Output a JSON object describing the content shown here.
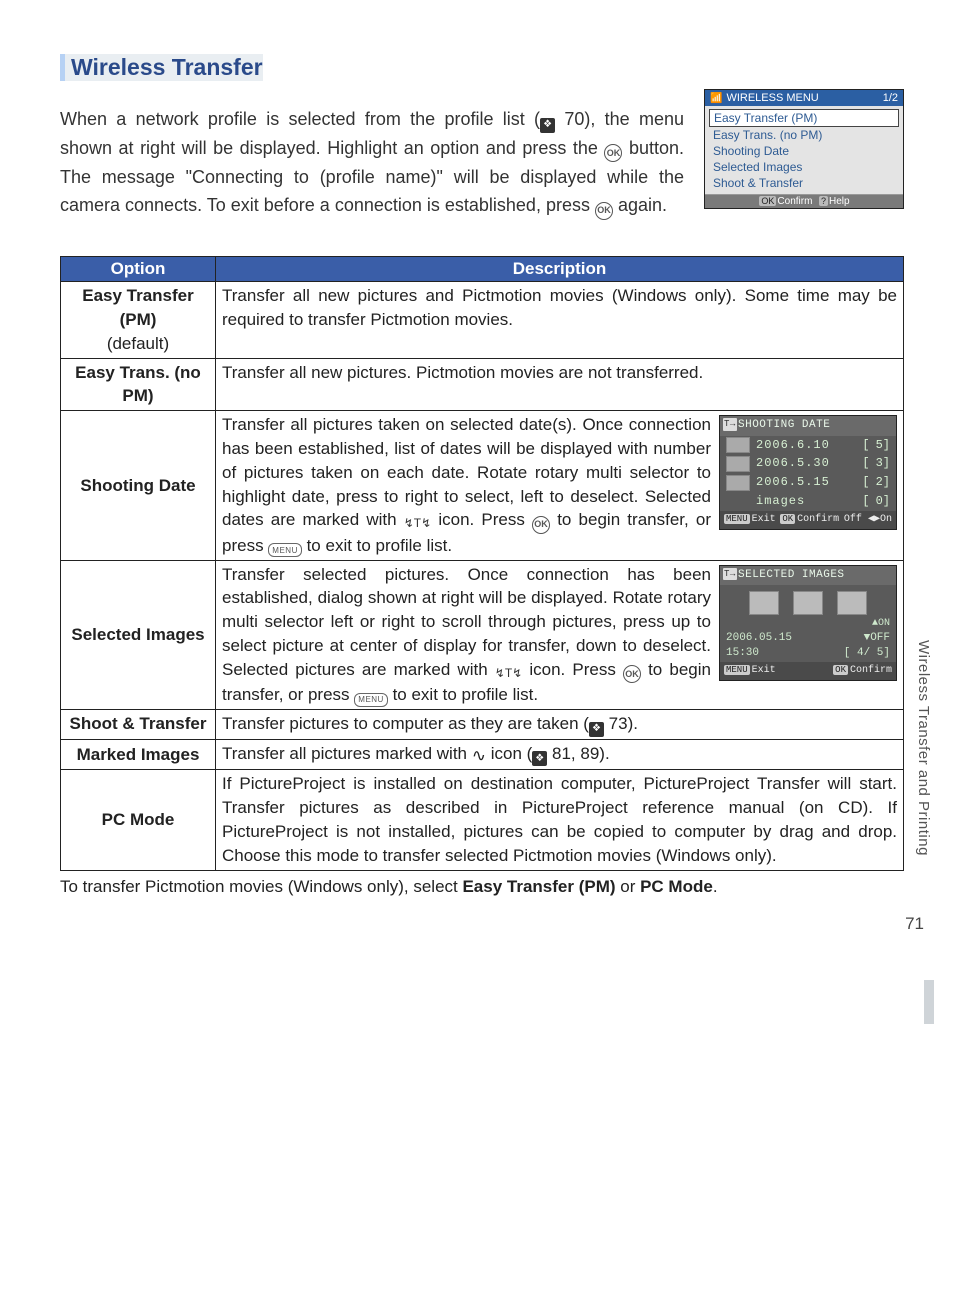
{
  "heading": "Wireless Transfer",
  "intro": {
    "part1": "When a network profile is selected from the profile list (",
    "ref1": "70",
    "part2": "), the menu shown at right will be displayed. Highlight an option and press the ",
    "ok1": "OK",
    "part3": " button. The message \"Connecting to (profile name)\" will be displayed while the camera connects. To exit before a connection is established, press ",
    "ok2": "OK",
    "part4": " again."
  },
  "menu_shot": {
    "title": "WIRELESS MENU",
    "page": "1/2",
    "items": [
      "Easy Transfer (PM)",
      "Easy Trans. (no PM)",
      "Shooting Date",
      "Selected Images",
      "Shoot & Transfer"
    ],
    "foot_confirm": "Confirm",
    "foot_help": "Help",
    "ok_chip": "OK",
    "help_chip": "?"
  },
  "table": {
    "headers": {
      "option": "Option",
      "description": "Description"
    },
    "rows": [
      {
        "option": "Easy Transfer (PM)",
        "option_sub": "(default)",
        "desc": "Transfer all new pictures and Pictmotion movies (Windows only). Some time may be required to transfer Pictmotion movies."
      },
      {
        "option": "Easy Trans. (no PM)",
        "desc": "Transfer all new pictures. Pictmotion movies are not transferred."
      },
      {
        "option": "Shooting Date",
        "desc": "Transfer all pictures taken on selected date(s). Once connection has been established, list of dates will be displayed with number of pictures taken on each date. Rotate rotary multi selector to highlight date, press to right to select, left to deselect. Selected dates are marked with ",
        "desc_tail": " icon. Press ",
        "desc_tail2": " to begin transfer, or press ",
        "desc_tail3": " to exit to profile list.",
        "inset": {
          "title": "SHOOTING DATE",
          "rows": [
            {
              "label": "2006.6.10",
              "val": "5]"
            },
            {
              "label": "2006.5.30",
              "val": "3]"
            },
            {
              "label": "2006.5.15",
              "val": "2]"
            },
            {
              "label": "images",
              "val": "0]"
            }
          ],
          "foot_exit": "Exit",
          "foot_confirm": "Confirm",
          "foot_off": "Off",
          "foot_on": "On",
          "menu_chip": "MENU",
          "ok_chip": "OK"
        }
      },
      {
        "option": "Selected Images",
        "desc": "Transfer selected pictures. Once connection has been established, dialog shown at right will be displayed. Rotate rotary multi selector left or right to scroll through pictures, press up to select picture at center of display for transfer, down to deselect. Selected pictures are marked with ",
        "desc_tail": " icon. Press ",
        "desc_tail2": " to begin transfer, or press ",
        "desc_tail3": " to exit to profile list.",
        "inset": {
          "title": "SELECTED IMAGES",
          "arrow_on": "▲ON",
          "arrow_off": "▼OFF",
          "date": "2006.05.15",
          "time": "15:30",
          "count": "[   4/   5]",
          "foot_exit": "Exit",
          "foot_confirm": "Confirm",
          "menu_chip": "MENU",
          "ok_chip": "OK"
        }
      },
      {
        "option": "Shoot & Transfer",
        "desc": "Transfer pictures to computer as they are taken (",
        "ref": "73",
        "desc_tail": ")."
      },
      {
        "option": "Marked Images",
        "desc": "Transfer all pictures marked with ",
        "desc_tail": " icon (",
        "refs": "81, 89",
        "desc_tail2": ")."
      },
      {
        "option": "PC Mode",
        "desc": "If PictureProject is installed on destination computer, PictureProject Transfer will start. Transfer pictures as described in PictureProject reference manual (on CD). If PictureProject is not installed, pictures can be copied to computer by drag and drop. Choose this mode to transfer selected Pictmotion movies (Windows only)."
      }
    ]
  },
  "after_table": {
    "p1": "To transfer Pictmotion movies (Windows only), select ",
    "b1": "Easy Transfer (PM)",
    "p2": " or ",
    "b2": "PC Mode",
    "p3": "."
  },
  "side_tab": "Wireless Transfer and Printing",
  "page_number": "71",
  "icons": {
    "ok": "OK",
    "menu": "MENU",
    "ref_glyph": "❖",
    "transfer_glyph": "↯T↯",
    "wave_glyph": "∿"
  }
}
